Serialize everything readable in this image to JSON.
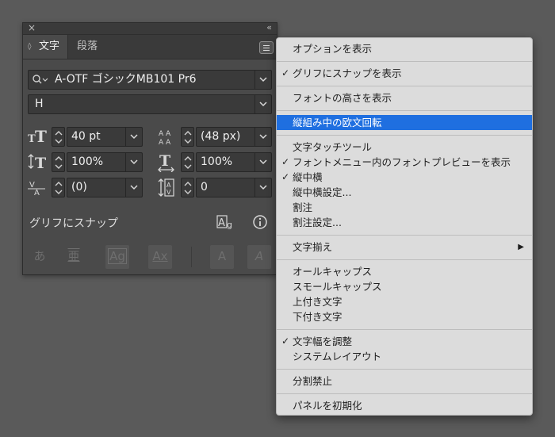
{
  "panel": {
    "close_icon": "×",
    "collapse_icon": "‹‹",
    "tabs": [
      {
        "label": "文字",
        "active": true
      },
      {
        "label": "段落",
        "active": false
      }
    ],
    "font_family": "A-OTF ゴシックMB101 Pr6",
    "font_style": "H",
    "font_size": "40 pt",
    "leading": "(48 px)",
    "vertical_scale": "100%",
    "horizontal_scale": "100%",
    "kerning": "(0)",
    "tracking": "0",
    "glyph_snap_label": "グリフにスナップ",
    "bottom_buttons": [
      "あ",
      "亜",
      "Ag",
      "Ax",
      "A",
      "A"
    ]
  },
  "menu": {
    "items": [
      {
        "label": "オプションを表示",
        "checked": false
      },
      {
        "label": "グリフにスナップを表示",
        "checked": true
      },
      {
        "label": "フォントの高さを表示",
        "checked": false
      },
      {
        "label": "縦組み中の欧文回転",
        "checked": false,
        "highlighted": true
      },
      {
        "label": "文字タッチツール",
        "checked": false
      },
      {
        "label": "フォントメニュー内のフォントプレビューを表示",
        "checked": true
      },
      {
        "label": "縦中横",
        "checked": true
      },
      {
        "label": "縦中横設定...",
        "checked": false
      },
      {
        "label": "割注",
        "checked": false
      },
      {
        "label": "割注設定...",
        "checked": false
      },
      {
        "label": "文字揃え",
        "checked": false,
        "submenu": true
      },
      {
        "label": "オールキャップス",
        "checked": false
      },
      {
        "label": "スモールキャップス",
        "checked": false
      },
      {
        "label": "上付き文字",
        "checked": false
      },
      {
        "label": "下付き文字",
        "checked": false
      },
      {
        "label": "文字幅を調整",
        "checked": true
      },
      {
        "label": "システムレイアウト",
        "checked": false
      },
      {
        "label": "分割禁止",
        "checked": false
      },
      {
        "label": "パネルを初期化",
        "checked": false
      }
    ],
    "check_glyph": "✓",
    "submenu_glyph": "▶",
    "highlight_color": "#1f6fe0"
  }
}
